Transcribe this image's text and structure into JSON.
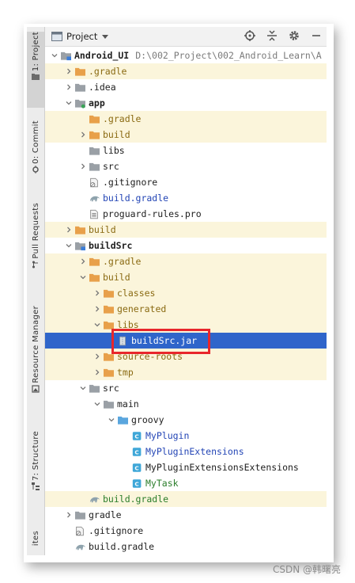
{
  "toolbar": {
    "title": "Project",
    "icons": [
      "locate-target-icon",
      "collapse-all-icon",
      "gear-icon",
      "minimize-icon"
    ]
  },
  "side_tabs": [
    {
      "label": "1: Project",
      "icon": "folder-icon"
    },
    {
      "label": "0: Commit",
      "icon": "commit-icon"
    },
    {
      "label": "Pull Requests",
      "icon": "pull-request-icon"
    },
    {
      "label": "Resource Manager",
      "icon": "resource-icon"
    },
    {
      "label": "7: Structure",
      "icon": "structure-icon"
    },
    {
      "label": "ites",
      "icon": ""
    }
  ],
  "tree": [
    {
      "label": "Android_UI",
      "path": "D:\\002_Project\\002_Android_Learn\\A",
      "icon": "module-folder",
      "arrow": "down",
      "depth": 0,
      "style": "bold",
      "bg": "none"
    },
    {
      "label": ".gradle",
      "icon": "folder-orange",
      "arrow": "right",
      "depth": 1,
      "style": "olive",
      "bg": "excluded"
    },
    {
      "label": ".idea",
      "icon": "folder-gray",
      "arrow": "right",
      "depth": 1,
      "style": "normal",
      "bg": "none"
    },
    {
      "label": "app",
      "icon": "module-folder-green",
      "arrow": "down",
      "depth": 1,
      "style": "bold",
      "bg": "none"
    },
    {
      "label": ".gradle",
      "icon": "folder-orange",
      "arrow": "none",
      "depth": 2,
      "style": "olive",
      "bg": "excluded"
    },
    {
      "label": "build",
      "icon": "folder-orange",
      "arrow": "right",
      "depth": 2,
      "style": "olive",
      "bg": "excluded"
    },
    {
      "label": "libs",
      "icon": "folder-gray",
      "arrow": "none",
      "depth": 2,
      "style": "normal",
      "bg": "none"
    },
    {
      "label": "src",
      "icon": "folder-gray",
      "arrow": "right",
      "depth": 2,
      "style": "normal",
      "bg": "none"
    },
    {
      "label": ".gitignore",
      "icon": "ignore-file",
      "arrow": "none",
      "depth": 2,
      "style": "normal",
      "bg": "none"
    },
    {
      "label": "build.gradle",
      "icon": "gradle-elephant",
      "arrow": "none",
      "depth": 2,
      "style": "blue",
      "bg": "none"
    },
    {
      "label": "proguard-rules.pro",
      "icon": "text-file",
      "arrow": "none",
      "depth": 2,
      "style": "normal",
      "bg": "none"
    },
    {
      "label": "build",
      "icon": "folder-orange",
      "arrow": "right",
      "depth": 1,
      "style": "olive",
      "bg": "excluded"
    },
    {
      "label": "buildSrc",
      "icon": "module-folder-blue",
      "arrow": "down",
      "depth": 1,
      "style": "bold",
      "bg": "none"
    },
    {
      "label": ".gradle",
      "icon": "folder-orange",
      "arrow": "right",
      "depth": 2,
      "style": "olive",
      "bg": "excluded"
    },
    {
      "label": "build",
      "icon": "folder-orange",
      "arrow": "down",
      "depth": 2,
      "style": "olive",
      "bg": "excluded"
    },
    {
      "label": "classes",
      "icon": "folder-orange",
      "arrow": "right",
      "depth": 3,
      "style": "olive",
      "bg": "excluded"
    },
    {
      "label": "generated",
      "icon": "folder-orange",
      "arrow": "right",
      "depth": 3,
      "style": "olive",
      "bg": "excluded"
    },
    {
      "label": "libs",
      "icon": "folder-orange",
      "arrow": "down",
      "depth": 3,
      "style": "olive",
      "bg": "excluded"
    },
    {
      "label": "buildSrc.jar",
      "icon": "jar-file",
      "arrow": "none",
      "depth": 4,
      "style": "normal",
      "bg": "selected"
    },
    {
      "label": "source-roots",
      "icon": "folder-orange",
      "arrow": "right",
      "depth": 3,
      "style": "olive",
      "bg": "excluded"
    },
    {
      "label": "tmp",
      "icon": "folder-orange",
      "arrow": "right",
      "depth": 3,
      "style": "olive",
      "bg": "excluded"
    },
    {
      "label": "src",
      "icon": "folder-gray",
      "arrow": "down",
      "depth": 2,
      "style": "normal",
      "bg": "none"
    },
    {
      "label": "main",
      "icon": "folder-gray",
      "arrow": "down",
      "depth": 3,
      "style": "normal",
      "bg": "none"
    },
    {
      "label": "groovy",
      "icon": "folder-blue",
      "arrow": "down",
      "depth": 4,
      "style": "normal",
      "bg": "none"
    },
    {
      "label": "MyPlugin",
      "icon": "class-c",
      "arrow": "none",
      "depth": 5,
      "style": "blue",
      "bg": "none"
    },
    {
      "label": "MyPluginExtensions",
      "icon": "class-c",
      "arrow": "none",
      "depth": 5,
      "style": "blue",
      "bg": "none"
    },
    {
      "label": "MyPluginExtensionsExtensions",
      "icon": "class-c",
      "arrow": "none",
      "depth": 5,
      "style": "normal",
      "bg": "none"
    },
    {
      "label": "MyTask",
      "icon": "class-c",
      "arrow": "none",
      "depth": 5,
      "style": "green",
      "bg": "none"
    },
    {
      "label": "build.gradle",
      "icon": "gradle-elephant",
      "arrow": "none",
      "depth": 2,
      "style": "green",
      "bg": "excluded"
    },
    {
      "label": "gradle",
      "icon": "folder-gray",
      "arrow": "right",
      "depth": 1,
      "style": "normal",
      "bg": "none"
    },
    {
      "label": ".gitignore",
      "icon": "ignore-file",
      "arrow": "none",
      "depth": 1,
      "style": "normal",
      "bg": "none"
    },
    {
      "label": "build.gradle",
      "icon": "gradle-elephant",
      "arrow": "none",
      "depth": 1,
      "style": "normal",
      "bg": "none"
    }
  ],
  "watermark": "CSDN @韩曙亮",
  "colors": {
    "selection": "#2f65ca",
    "excluded_bg": "#fbf5db",
    "folder_orange": "#e8a04a",
    "folder_gray": "#9aa0a6",
    "folder_blue": "#5aa6de",
    "class_icon": "#3fa7d8",
    "highlight_box": "#e8262b"
  }
}
